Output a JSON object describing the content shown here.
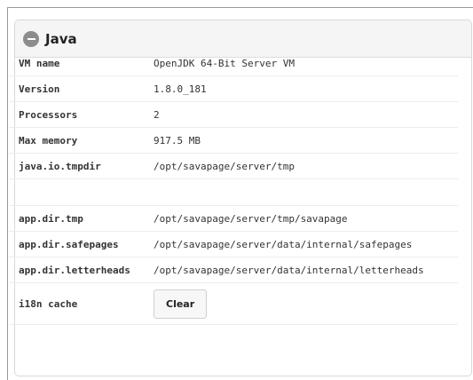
{
  "panel": {
    "title": "Java",
    "icon": "minus-circle-icon"
  },
  "rows": [
    {
      "key": "VM name",
      "value": "OpenJDK 64-Bit Server VM"
    },
    {
      "key": "Version",
      "value": "1.8.0_181"
    },
    {
      "key": "Processors",
      "value": "2"
    },
    {
      "key": "Max memory",
      "value": "917.5 MB"
    },
    {
      "key": "java.io.tmpdir",
      "value": "/opt/savapage/server/tmp"
    }
  ],
  "app_rows": [
    {
      "key": "app.dir.tmp",
      "value": "/opt/savapage/server/tmp/savapage"
    },
    {
      "key": "app.dir.safepages",
      "value": "/opt/savapage/server/data/internal/safepages"
    },
    {
      "key": "app.dir.letterheads",
      "value": "/opt/savapage/server/data/internal/letterheads"
    }
  ],
  "i18n": {
    "key": "i18n cache",
    "button_label": "Clear"
  }
}
